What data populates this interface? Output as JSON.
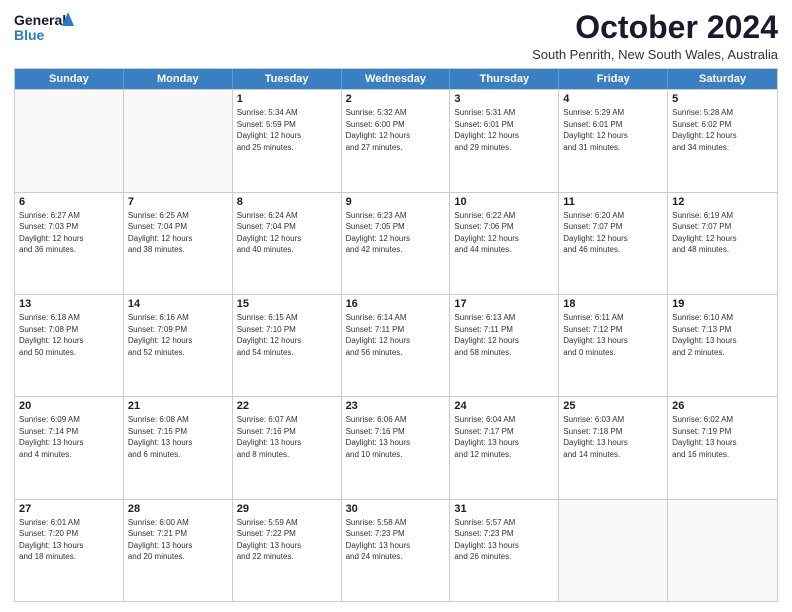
{
  "logo": {
    "line1": "General",
    "line2": "Blue"
  },
  "title": "October 2024",
  "subtitle": "South Penrith, New South Wales, Australia",
  "days": [
    "Sunday",
    "Monday",
    "Tuesday",
    "Wednesday",
    "Thursday",
    "Friday",
    "Saturday"
  ],
  "weeks": [
    [
      {
        "day": "",
        "info": ""
      },
      {
        "day": "",
        "info": ""
      },
      {
        "day": "1",
        "info": "Sunrise: 5:34 AM\nSunset: 5:59 PM\nDaylight: 12 hours\nand 25 minutes."
      },
      {
        "day": "2",
        "info": "Sunrise: 5:32 AM\nSunset: 6:00 PM\nDaylight: 12 hours\nand 27 minutes."
      },
      {
        "day": "3",
        "info": "Sunrise: 5:31 AM\nSunset: 6:01 PM\nDaylight: 12 hours\nand 29 minutes."
      },
      {
        "day": "4",
        "info": "Sunrise: 5:29 AM\nSunset: 6:01 PM\nDaylight: 12 hours\nand 31 minutes."
      },
      {
        "day": "5",
        "info": "Sunrise: 5:28 AM\nSunset: 6:02 PM\nDaylight: 12 hours\nand 34 minutes."
      }
    ],
    [
      {
        "day": "6",
        "info": "Sunrise: 6:27 AM\nSunset: 7:03 PM\nDaylight: 12 hours\nand 36 minutes."
      },
      {
        "day": "7",
        "info": "Sunrise: 6:25 AM\nSunset: 7:04 PM\nDaylight: 12 hours\nand 38 minutes."
      },
      {
        "day": "8",
        "info": "Sunrise: 6:24 AM\nSunset: 7:04 PM\nDaylight: 12 hours\nand 40 minutes."
      },
      {
        "day": "9",
        "info": "Sunrise: 6:23 AM\nSunset: 7:05 PM\nDaylight: 12 hours\nand 42 minutes."
      },
      {
        "day": "10",
        "info": "Sunrise: 6:22 AM\nSunset: 7:06 PM\nDaylight: 12 hours\nand 44 minutes."
      },
      {
        "day": "11",
        "info": "Sunrise: 6:20 AM\nSunset: 7:07 PM\nDaylight: 12 hours\nand 46 minutes."
      },
      {
        "day": "12",
        "info": "Sunrise: 6:19 AM\nSunset: 7:07 PM\nDaylight: 12 hours\nand 48 minutes."
      }
    ],
    [
      {
        "day": "13",
        "info": "Sunrise: 6:18 AM\nSunset: 7:08 PM\nDaylight: 12 hours\nand 50 minutes."
      },
      {
        "day": "14",
        "info": "Sunrise: 6:16 AM\nSunset: 7:09 PM\nDaylight: 12 hours\nand 52 minutes."
      },
      {
        "day": "15",
        "info": "Sunrise: 6:15 AM\nSunset: 7:10 PM\nDaylight: 12 hours\nand 54 minutes."
      },
      {
        "day": "16",
        "info": "Sunrise: 6:14 AM\nSunset: 7:11 PM\nDaylight: 12 hours\nand 56 minutes."
      },
      {
        "day": "17",
        "info": "Sunrise: 6:13 AM\nSunset: 7:11 PM\nDaylight: 12 hours\nand 58 minutes."
      },
      {
        "day": "18",
        "info": "Sunrise: 6:11 AM\nSunset: 7:12 PM\nDaylight: 13 hours\nand 0 minutes."
      },
      {
        "day": "19",
        "info": "Sunrise: 6:10 AM\nSunset: 7:13 PM\nDaylight: 13 hours\nand 2 minutes."
      }
    ],
    [
      {
        "day": "20",
        "info": "Sunrise: 6:09 AM\nSunset: 7:14 PM\nDaylight: 13 hours\nand 4 minutes."
      },
      {
        "day": "21",
        "info": "Sunrise: 6:08 AM\nSunset: 7:15 PM\nDaylight: 13 hours\nand 6 minutes."
      },
      {
        "day": "22",
        "info": "Sunrise: 6:07 AM\nSunset: 7:16 PM\nDaylight: 13 hours\nand 8 minutes."
      },
      {
        "day": "23",
        "info": "Sunrise: 6:06 AM\nSunset: 7:16 PM\nDaylight: 13 hours\nand 10 minutes."
      },
      {
        "day": "24",
        "info": "Sunrise: 6:04 AM\nSunset: 7:17 PM\nDaylight: 13 hours\nand 12 minutes."
      },
      {
        "day": "25",
        "info": "Sunrise: 6:03 AM\nSunset: 7:18 PM\nDaylight: 13 hours\nand 14 minutes."
      },
      {
        "day": "26",
        "info": "Sunrise: 6:02 AM\nSunset: 7:19 PM\nDaylight: 13 hours\nand 16 minutes."
      }
    ],
    [
      {
        "day": "27",
        "info": "Sunrise: 6:01 AM\nSunset: 7:20 PM\nDaylight: 13 hours\nand 18 minutes."
      },
      {
        "day": "28",
        "info": "Sunrise: 6:00 AM\nSunset: 7:21 PM\nDaylight: 13 hours\nand 20 minutes."
      },
      {
        "day": "29",
        "info": "Sunrise: 5:59 AM\nSunset: 7:22 PM\nDaylight: 13 hours\nand 22 minutes."
      },
      {
        "day": "30",
        "info": "Sunrise: 5:58 AM\nSunset: 7:23 PM\nDaylight: 13 hours\nand 24 minutes."
      },
      {
        "day": "31",
        "info": "Sunrise: 5:57 AM\nSunset: 7:23 PM\nDaylight: 13 hours\nand 26 minutes."
      },
      {
        "day": "",
        "info": ""
      },
      {
        "day": "",
        "info": ""
      }
    ]
  ]
}
